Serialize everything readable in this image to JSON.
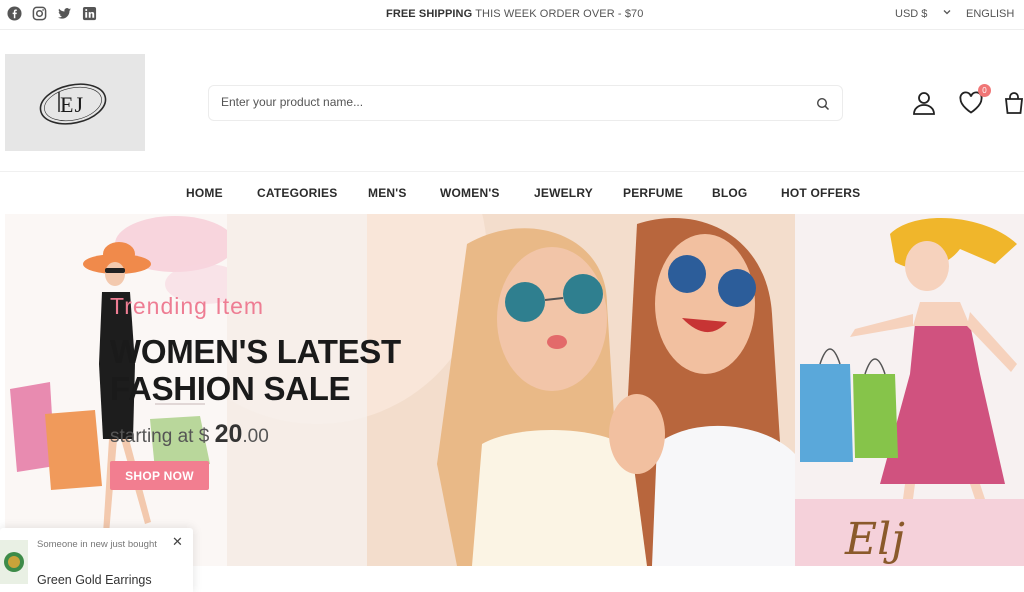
{
  "topbar": {
    "social_icons": [
      "facebook-icon",
      "instagram-icon",
      "twitter-icon",
      "linkedin-icon"
    ],
    "shipping_strong": "FREE SHIPPING",
    "shipping_rest": " THIS WEEK ORDER OVER - $70",
    "currency": "USD $",
    "language": "ENGLISH"
  },
  "header": {
    "logo_text": "EJ",
    "search_placeholder": "Enter your product name...",
    "wishlist_count": "0"
  },
  "nav": {
    "items": [
      "HOME",
      "CATEGORIES",
      "MEN'S",
      "WOMEN'S",
      "JEWELRY",
      "PERFUME",
      "BLOG",
      "HOT OFFERS"
    ]
  },
  "banner": {
    "subtitle": "Trending Item",
    "headline_line1": "WOMEN'S LATEST",
    "headline_line2": "FASHION SALE",
    "starting_text": "starting at $ ",
    "price_main": "20",
    "price_cents": ".00",
    "button_label": "SHOP NOW",
    "watermark": "Elj"
  },
  "popup": {
    "notice": "Someone in new just bought",
    "product": "Green Gold Earrings"
  },
  "colors": {
    "accent_pink": "#f27e90",
    "badge": "#f07676"
  }
}
